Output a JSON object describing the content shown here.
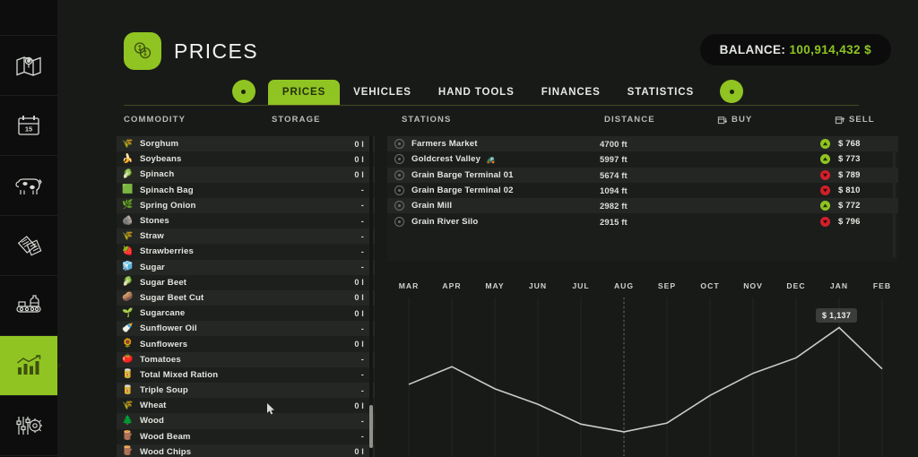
{
  "sidebar": {
    "items": [
      {
        "name": "map",
        "icon": "map-icon",
        "active": false
      },
      {
        "name": "calendar",
        "icon": "calendar-icon",
        "label": "15",
        "active": false
      },
      {
        "name": "animals",
        "icon": "cow-icon",
        "active": false
      },
      {
        "name": "contracts",
        "icon": "documents-icon",
        "active": false
      },
      {
        "name": "production",
        "icon": "factory-icon",
        "active": false
      },
      {
        "name": "statistics",
        "icon": "bar-chart-icon",
        "active": true
      },
      {
        "name": "settings",
        "icon": "sliders-gear-icon",
        "active": false
      }
    ]
  },
  "header": {
    "title": "PRICES",
    "title_icon": "coins-icon",
    "balance_label": "BALANCE:",
    "balance_value": "100,914,432 $",
    "accent_color": "#8fc422",
    "balance_color": "#8fc422"
  },
  "tabs": {
    "prev_label": "prev-arrow",
    "next_label": "next-arrow",
    "items": [
      {
        "label": "PRICES",
        "active": true
      },
      {
        "label": "VEHICLES",
        "active": false
      },
      {
        "label": "HAND TOOLS",
        "active": false
      },
      {
        "label": "FINANCES",
        "active": false
      },
      {
        "label": "STATISTICS",
        "active": false
      }
    ]
  },
  "columns": {
    "commodity": "COMMODITY",
    "storage": "STORAGE",
    "stations": "STATIONS",
    "distance": "DISTANCE",
    "buy": "BUY",
    "sell": "SELL"
  },
  "commodities": [
    {
      "name": "Sorghum",
      "storage": "0 l",
      "icon": "🌾"
    },
    {
      "name": "Soybeans",
      "storage": "0 l",
      "icon": "🍌"
    },
    {
      "name": "Spinach",
      "storage": "0 l",
      "icon": "🥬"
    },
    {
      "name": "Spinach Bag",
      "storage": "-",
      "icon": "🟩"
    },
    {
      "name": "Spring Onion",
      "storage": "-",
      "icon": "🌿"
    },
    {
      "name": "Stones",
      "storage": "-",
      "icon": "🪨"
    },
    {
      "name": "Straw",
      "storage": "-",
      "icon": "🌾"
    },
    {
      "name": "Strawberries",
      "storage": "-",
      "icon": "🍓"
    },
    {
      "name": "Sugar",
      "storage": "-",
      "icon": "🧊"
    },
    {
      "name": "Sugar Beet",
      "storage": "0 l",
      "icon": "🥬"
    },
    {
      "name": "Sugar Beet Cut",
      "storage": "0 l",
      "icon": "🥔"
    },
    {
      "name": "Sugarcane",
      "storage": "0 l",
      "icon": "🌱"
    },
    {
      "name": "Sunflower Oil",
      "storage": "-",
      "icon": "🍼"
    },
    {
      "name": "Sunflowers",
      "storage": "0 l",
      "icon": "🌻"
    },
    {
      "name": "Tomatoes",
      "storage": "-",
      "icon": "🍅"
    },
    {
      "name": "Total Mixed Ration",
      "storage": "-",
      "icon": "🥫"
    },
    {
      "name": "Triple Soup",
      "storage": "-",
      "icon": "🥫"
    },
    {
      "name": "Wheat",
      "storage": "0 l",
      "icon": "🌾"
    },
    {
      "name": "Wood",
      "storage": "-",
      "icon": "🌲"
    },
    {
      "name": "Wood Beam",
      "storage": "-",
      "icon": "🪵"
    },
    {
      "name": "Wood Chips",
      "storage": "0 l",
      "icon": "🪵"
    }
  ],
  "stations": [
    {
      "name": "Farmers Market",
      "distance": "4700 ft",
      "trend": "up",
      "price": "$ 768",
      "badge": ""
    },
    {
      "name": "Goldcrest Valley",
      "distance": "5997 ft",
      "trend": "up",
      "price": "$ 773",
      "badge": "🚜"
    },
    {
      "name": "Grain Barge Terminal 01",
      "distance": "5674 ft",
      "trend": "down",
      "price": "$ 789",
      "badge": ""
    },
    {
      "name": "Grain Barge Terminal 02",
      "distance": "1094 ft",
      "trend": "down",
      "price": "$ 810",
      "badge": ""
    },
    {
      "name": "Grain Mill",
      "distance": "2982 ft",
      "trend": "up",
      "price": "$ 772",
      "badge": ""
    },
    {
      "name": "Grain River Silo",
      "distance": "2915 ft",
      "trend": "down",
      "price": "$ 796",
      "badge": ""
    }
  ],
  "chart_data": {
    "type": "line",
    "title": "",
    "xlabel": "",
    "ylabel": "",
    "categories": [
      "MAR",
      "APR",
      "MAY",
      "JUN",
      "JUL",
      "AUG",
      "SEP",
      "OCT",
      "NOV",
      "DEC",
      "JAN",
      "FEB"
    ],
    "values": [
      880,
      960,
      860,
      790,
      700,
      665,
      705,
      830,
      930,
      1000,
      1137,
      950
    ],
    "ylim": [
      600,
      1200
    ],
    "grid": true,
    "legend": "none",
    "annotations": [
      {
        "label": "$ 1,137",
        "category": "JAN",
        "value": 1137
      }
    ],
    "marker_line": {
      "category": "AUG",
      "style": "dotted"
    },
    "line_color": "#c9ccc6"
  }
}
